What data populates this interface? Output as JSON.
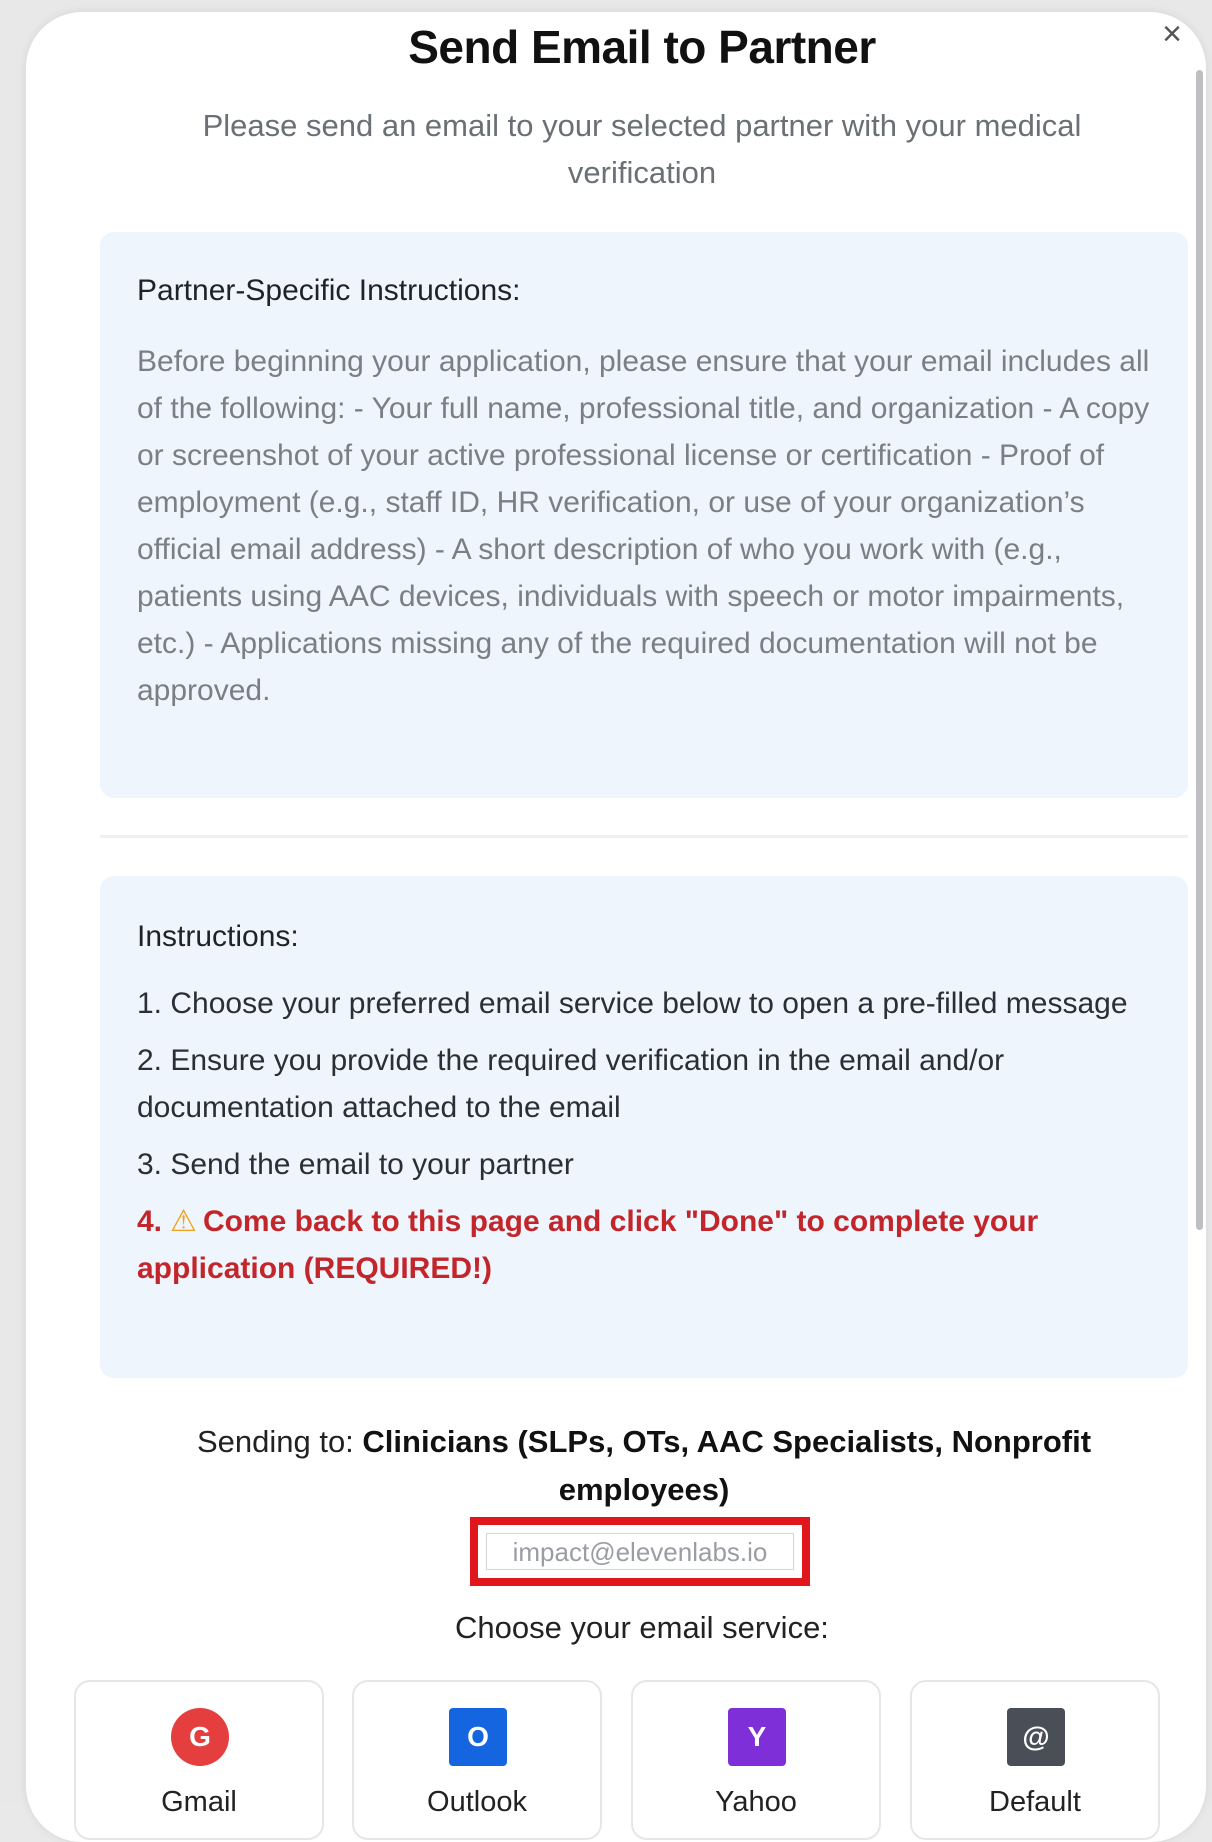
{
  "modal": {
    "title": "Send Email to Partner",
    "close_glyph": "×",
    "subtitle": "Please send an email to your selected partner with your medical verification"
  },
  "partner_instructions": {
    "heading": "Partner-Specific Instructions:",
    "body": "Before beginning your application, please ensure that your email includes all of the following: - Your full name, professional title, and organization - A copy or screenshot of your active professional license or certification - Proof of employment (e.g., staff ID, HR verification, or use of your organization’s official email address) - A short description of who you work with (e.g., patients using AAC devices, individuals with speech or motor impairments, etc.) - Applications missing any of the required documentation will not be approved."
  },
  "instructions": {
    "heading": "Instructions:",
    "step1": "1. Choose your preferred email service below to open a pre-filled message",
    "step2": "2. Ensure you provide the required verification in the email and/or documentation attached to the email",
    "step3": "3. Send the email to your partner",
    "step4_number": "4.",
    "step4_icon": "⚠",
    "step4_text": "Come back to this page and click \"Done\" to complete your application (REQUIRED!)"
  },
  "recipient": {
    "prefix": "Sending to: ",
    "name": "Clinicians (SLPs, OTs, AAC Specialists, Nonprofit employees)",
    "email": "impact@elevenlabs.io"
  },
  "services": {
    "prompt": "Choose your email service:",
    "items": [
      {
        "label": "Gmail",
        "glyph": "G",
        "color": "#e53e3e"
      },
      {
        "label": "Outlook",
        "glyph": "O",
        "color": "#1565e0"
      },
      {
        "label": "Yahoo",
        "glyph": "Y",
        "color": "#7e2fd8"
      },
      {
        "label": "Default",
        "glyph": "@",
        "color": "#4a4f57"
      }
    ]
  },
  "colors": {
    "panel_bg": "#eef5fd",
    "warning_text": "#c3262a",
    "highlight_border": "#e0161c"
  }
}
